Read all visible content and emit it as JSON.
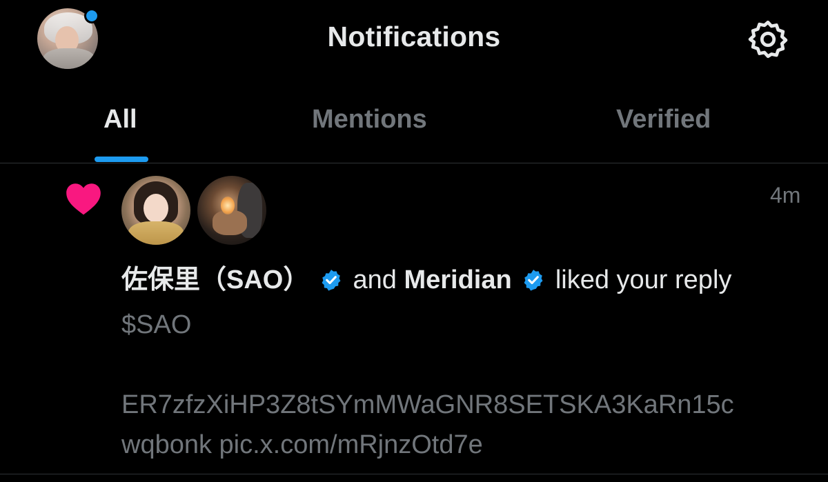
{
  "header": {
    "title": "Notifications",
    "avatar_icon": "user-avatar",
    "settings_icon": "gear-icon"
  },
  "tabs": [
    {
      "label": "All",
      "active": true
    },
    {
      "label": "Mentions",
      "active": false
    },
    {
      "label": "Verified",
      "active": false
    }
  ],
  "notification": {
    "type_icon": "heart-icon",
    "time": "4m",
    "user1": "佐保里（SAO）",
    "connector": "and",
    "user2": "Meridian",
    "action": "liked your reply",
    "tweet_lines": [
      "$SAO",
      "ER7zfzXiHP3Z8tSYmMWaGNR8SETSKA3KaRn15c",
      "wqbonk pic.x.com/mRjnzOtd7e"
    ]
  },
  "colors": {
    "accent": "#1d9bf0",
    "like": "#f91880",
    "muted_text": "#71767b",
    "primary_text": "#e7e9ea",
    "background": "#000000"
  }
}
